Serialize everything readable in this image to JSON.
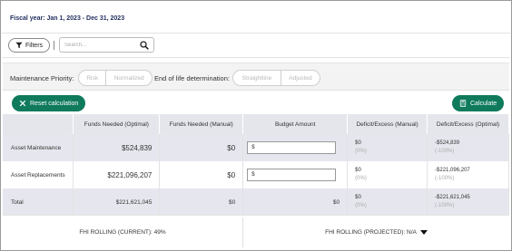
{
  "header": {
    "fiscal_year": "Fiscal year: Jan 1, 2023 - Dec 31, 2023"
  },
  "toolbar": {
    "filters_label": "Filters",
    "search_placeholder": "Search..."
  },
  "options": {
    "maintenance_priority_label": "Maintenance Priority:",
    "maintenance_priority_options": [
      "Risk",
      "Normalized"
    ],
    "end_of_life_label": "End of life determination:",
    "end_of_life_options": [
      "Straightline",
      "Adjusted"
    ]
  },
  "actions": {
    "reset_label": "Reset calculation",
    "calculate_label": "Calculate"
  },
  "table": {
    "headers": [
      "",
      "Funds Needed (Optimal)",
      "Funds Needed (Manual)",
      "Budget Amount",
      "Deficit/Excess (Manual)",
      "Deficit/Excess (Optimal)"
    ],
    "rows": [
      {
        "name": "Asset Maintenance",
        "optimal": "$524,839",
        "manual": "$0",
        "budget": "$",
        "def_manual": "$0",
        "def_manual_pct": "(0%)",
        "def_optimal": "-$524,839",
        "def_optimal_pct": "(-100%)"
      },
      {
        "name": "Asset Replacements",
        "optimal": "$221,096,207",
        "manual": "$0",
        "budget": "$",
        "def_manual": "$0",
        "def_manual_pct": "(0%)",
        "def_optimal": "-$221,096,207",
        "def_optimal_pct": "(-100%)"
      },
      {
        "name": "Total",
        "optimal": "$221,621,045",
        "manual": "$0",
        "budget": "$0",
        "def_manual": "$0",
        "def_manual_pct": "(0%)",
        "def_optimal": "-$221,621,045",
        "def_optimal_pct": "(-100%)"
      }
    ]
  },
  "footer": {
    "fhi_current": "FHI ROLLING (CURRENT): 49%",
    "fhi_projected": "FHI ROLLING (PROJECTED): N/A"
  },
  "colors": {
    "accent_green": "#0f7a5c",
    "header_bg": "#e4e6ec",
    "title_navy": "#1f2d5c"
  }
}
